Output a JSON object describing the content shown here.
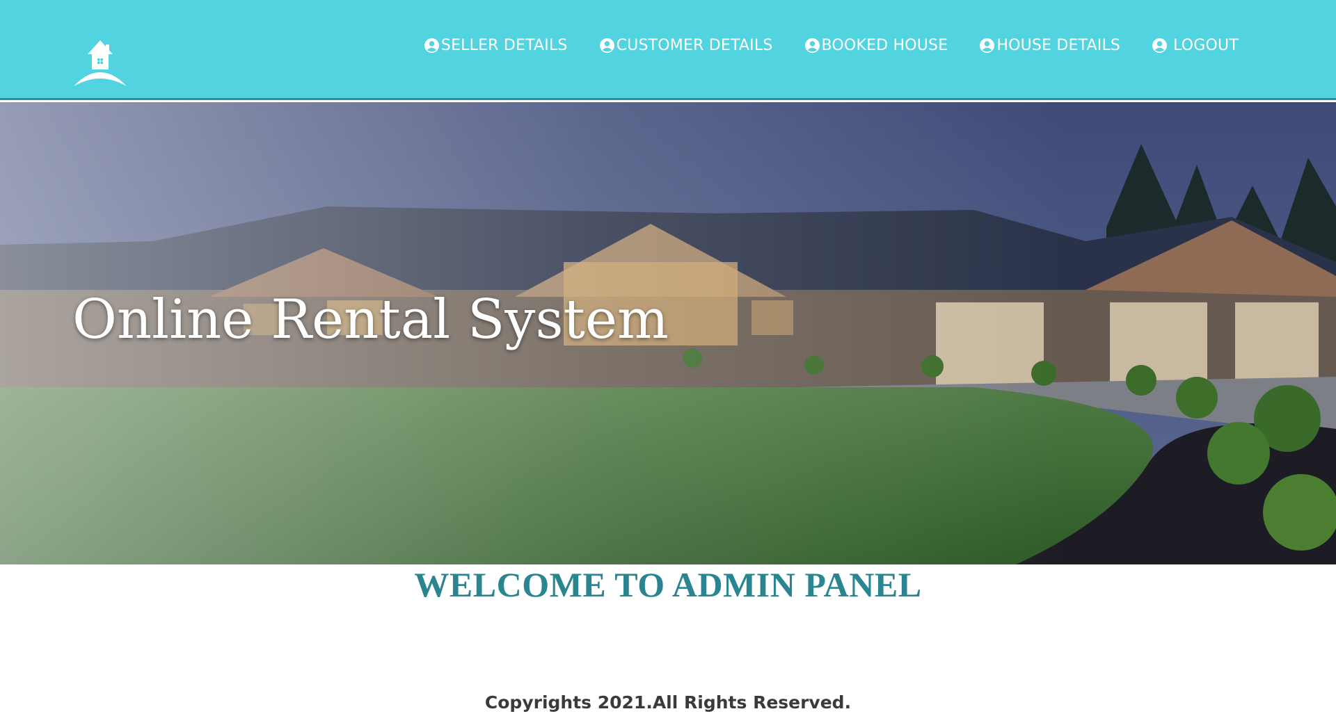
{
  "header": {
    "nav": [
      {
        "label": "SELLER DETAILS",
        "icon": "user-circle-icon"
      },
      {
        "label": "CUSTOMER DETAILS",
        "icon": "user-circle-icon"
      },
      {
        "label": "BOOKED HOUSE",
        "icon": "user-circle-icon"
      },
      {
        "label": "HOUSE DETAILS",
        "icon": "user-circle-icon"
      },
      {
        "label": "LOGOUT",
        "icon": "user-circle-icon"
      }
    ],
    "logo_icon": "house-logo-icon",
    "background_color": "#51d3e0"
  },
  "hero": {
    "title": "Online Rental System"
  },
  "main": {
    "welcome": "WELCOME TO ADMIN PANEL",
    "welcome_color": "#2b8590"
  },
  "footer": {
    "copyright": "Copyrights 2021.All Rights Reserved."
  }
}
